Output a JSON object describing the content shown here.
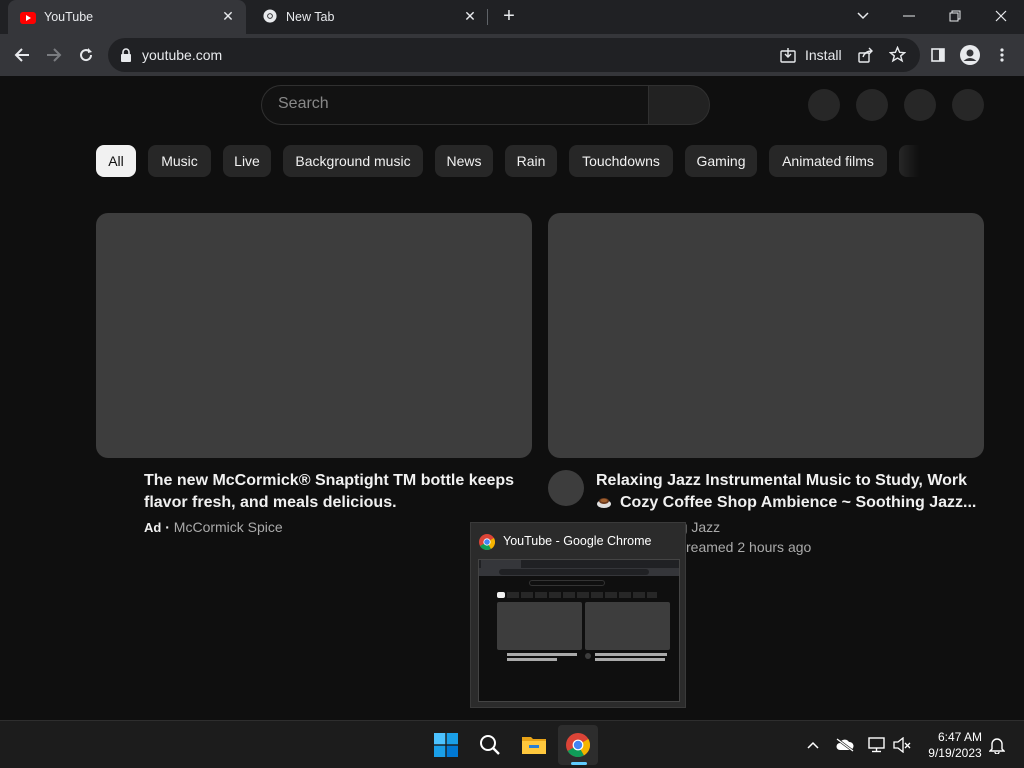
{
  "browser": {
    "tabs": [
      {
        "title": "YouTube",
        "active": true
      },
      {
        "title": "New Tab",
        "active": false
      }
    ],
    "url": "youtube.com",
    "install_label": "Install"
  },
  "youtube": {
    "search_placeholder": "Search",
    "chips": [
      "All",
      "Music",
      "Live",
      "Background music",
      "News",
      "Rain",
      "Touchdowns",
      "Gaming",
      "Animated films"
    ],
    "videos": [
      {
        "title": "The new McCormick® Snaptight TM bottle keeps flavor fresh, and meals delicious.",
        "ad_badge": "Ad",
        "separator": "·",
        "channel": "McCormick Spice"
      },
      {
        "title_line1": "Relaxing Jazz Instrumental Music to Study, Work",
        "title_line2": "Cozy Coffee Shop Ambience ~ Soothing Jazz...",
        "channel_fragment": "...g Jazz",
        "stats_fragment": "reamed 2 hours ago"
      }
    ]
  },
  "taskbar_preview": {
    "title": "YouTube - Google Chrome"
  },
  "taskbar": {
    "time": "6:47 AM",
    "date": "9/19/2023"
  },
  "colors": {
    "youtube_red": "#ff0000",
    "windows_blue": "#0078d4",
    "accent_indicator": "#60cdff"
  }
}
